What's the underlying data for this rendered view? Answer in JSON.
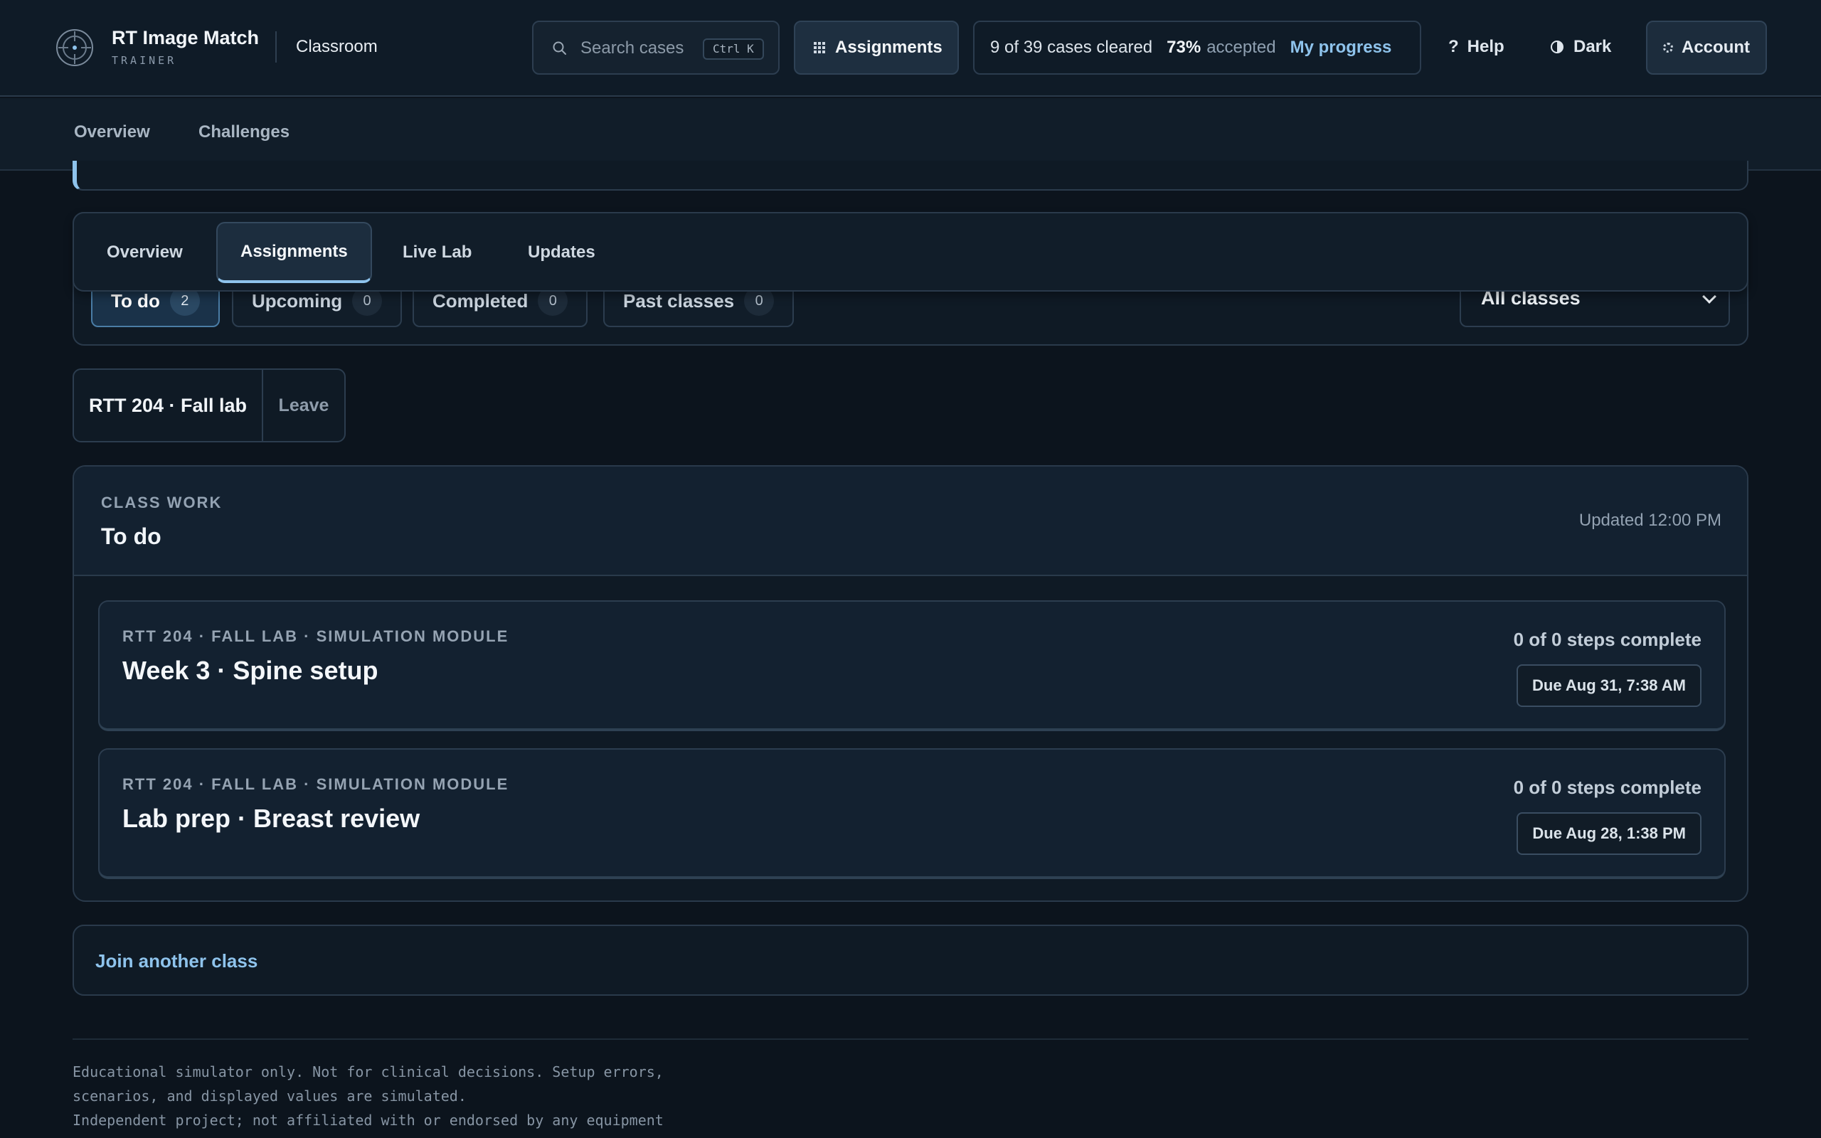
{
  "header": {
    "brand_name": "RT Image Match",
    "brand_sub": "TRAINER",
    "section": "Classroom",
    "search": {
      "placeholder": "Search cases",
      "shortcut": "Ctrl K"
    },
    "assignments_label": "Assignments",
    "progress": {
      "cleared_text": "9 of 39 cases cleared",
      "accepted_pct": "73%",
      "accepted_label": "accepted",
      "link": "My progress"
    },
    "help_label": "Help",
    "help_glyph": "?",
    "theme_label": "Dark",
    "account_label": "Account"
  },
  "subnav": {
    "items": [
      "Overview",
      "Challenges"
    ]
  },
  "tabs": {
    "items": [
      "Overview",
      "Assignments",
      "Live Lab",
      "Updates"
    ],
    "active": "Assignments"
  },
  "filters": {
    "chips": [
      {
        "label": "To do",
        "count": "2",
        "active": true
      },
      {
        "label": "Upcoming",
        "count": "0",
        "active": false
      },
      {
        "label": "Completed",
        "count": "0",
        "active": false
      },
      {
        "label": "Past classes",
        "count": "0",
        "active": false
      }
    ],
    "class_select": {
      "value": "All classes"
    }
  },
  "class_chip": {
    "name": "RTT 204 · Fall lab",
    "leave_label": "Leave"
  },
  "work": {
    "eyebrow": "CLASS WORK",
    "title": "To do",
    "updated": "Updated 12:00 PM",
    "assignments": [
      {
        "eyebrow": "RTT 204 · FALL LAB · SIMULATION MODULE",
        "title": "Week 3 · Spine setup",
        "steps": "0 of 0 steps complete",
        "due": "Due Aug 31, 7:38 AM"
      },
      {
        "eyebrow": "RTT 204 · FALL LAB · SIMULATION MODULE",
        "title": "Lab prep · Breast review",
        "steps": "0 of 0 steps complete",
        "due": "Due Aug 28, 1:38 PM"
      }
    ]
  },
  "join": {
    "label": "Join another class"
  },
  "footer": {
    "lines": [
      "Educational simulator only. Not for clinical decisions. Setup errors,",
      "scenarios, and displayed values are simulated.",
      "Independent project; not affiliated with or endorsed by any equipment"
    ]
  },
  "colors": {
    "accent": "#8ec3ec",
    "background": "#0c141d",
    "panel": "#0f1a25"
  }
}
